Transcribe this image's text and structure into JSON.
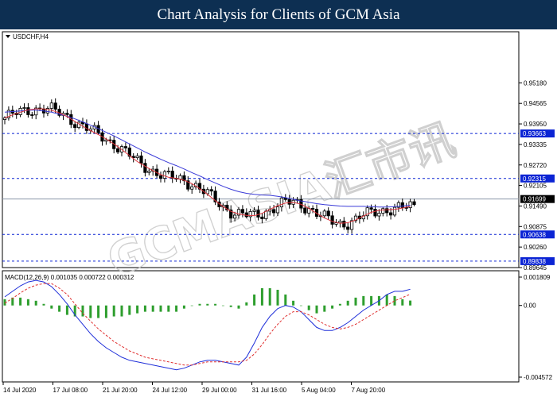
{
  "header": {
    "title": "Chart Analysis for Clients of GCM Asia"
  },
  "watermark": {
    "text": "GCMASIA汇市讯"
  },
  "colors": {
    "banner": "#0d2f52",
    "ma_fast": "#e0343c",
    "ma_slow": "#3a3ad8",
    "bull": "#ffffff",
    "bear": "#000000",
    "level_box": "#0b24d4",
    "macd_hist": "#2e9e2e",
    "macd_main": "#1f2fd9",
    "macd_signal": "#e03030"
  },
  "chart_data": [
    {
      "type": "candlestick",
      "title": "USDCHF,H4",
      "ylim": [
        0.89645,
        0.9614
      ],
      "y_ticks": [
        "0.95180",
        "0.94565",
        "0.93950",
        "0.93335",
        "0.92720",
        "0.92105",
        "0.91490",
        "0.90875",
        "0.90260",
        "0.89645"
      ],
      "x_ticks": [
        "14 Jul 2020",
        "17 Jul 08:00",
        "21 Jul 20:00",
        "24 Jul 12:00",
        "29 Jul 00:00",
        "31 Jul 16:00",
        "5 Aug 04:00",
        "7 Aug 20:00"
      ],
      "levels": [
        {
          "value": 0.93663,
          "label": "0.93663",
          "style": "dashed-blue"
        },
        {
          "value": 0.92315,
          "label": "0.92315",
          "style": "dashed-blue"
        },
        {
          "value": 0.90638,
          "label": "0.90638",
          "style": "dashed-blue"
        },
        {
          "value": 0.89838,
          "label": "0.89838",
          "style": "dashed-blue"
        }
      ],
      "current_price": {
        "value": 0.91699,
        "label": "0.91699"
      },
      "series": [
        {
          "role": "ma_fast",
          "values": [
            0.9413,
            0.9422,
            0.943,
            0.9437,
            0.944,
            0.944,
            0.9436,
            0.9428,
            0.9417,
            0.9402,
            0.9388,
            0.9375,
            0.9363,
            0.935,
            0.9335,
            0.9318,
            0.93,
            0.9282,
            0.9268,
            0.9255,
            0.9243,
            0.9235,
            0.9232,
            0.9226,
            0.9216,
            0.9201,
            0.9184,
            0.9165,
            0.9147,
            0.9133,
            0.9125,
            0.9121,
            0.912,
            0.9127,
            0.9139,
            0.915,
            0.9158,
            0.916,
            0.9154,
            0.9142,
            0.9127,
            0.9113,
            0.9103,
            0.9097,
            0.9099,
            0.9107,
            0.9119,
            0.913,
            0.9136,
            0.9138,
            0.9139,
            0.9143,
            0.9148
          ]
        },
        {
          "role": "ma_slow",
          "values": [
            0.943,
            0.9432,
            0.9434,
            0.9436,
            0.9436,
            0.9434,
            0.943,
            0.9424,
            0.9418,
            0.941,
            0.9401,
            0.9391,
            0.9381,
            0.937,
            0.9359,
            0.9347,
            0.9335,
            0.9323,
            0.9311,
            0.93,
            0.9289,
            0.9279,
            0.927,
            0.926,
            0.9249,
            0.9239,
            0.9228,
            0.9218,
            0.9208,
            0.9199,
            0.9192,
            0.9187,
            0.9184,
            0.9182,
            0.9181,
            0.9178,
            0.9174,
            0.9169,
            0.9164,
            0.916,
            0.9156,
            0.9153,
            0.9151,
            0.9149,
            0.9148,
            0.9148,
            0.9148,
            0.9147,
            0.9146,
            0.9146,
            0.9147,
            0.9149,
            0.9151
          ]
        }
      ]
    },
    {
      "type": "line+bar",
      "title": "MACD(12,26,9) 0.001035 0.000722 0.000312",
      "ylim": [
        -0.004572,
        0.001809
      ],
      "y_ticks": [
        "0.001809",
        "0.00",
        "-0.004572"
      ],
      "series": [
        {
          "role": "macd_main",
          "values": [
            0.00055,
            0.0009,
            0.00125,
            0.0015,
            0.0016,
            0.0015,
            0.0012,
            0.0007,
            0.0001,
            -0.0006,
            -0.0012,
            -0.0018,
            -0.0023,
            -0.0027,
            -0.003,
            -0.0033,
            -0.0035,
            -0.0036,
            -0.0037,
            -0.0038,
            -0.0039,
            -0.004,
            -0.0041,
            -0.004,
            -0.0038,
            -0.0036,
            -0.0035,
            -0.0035,
            -0.0036,
            -0.0037,
            -0.0038,
            -0.0033,
            -0.0024,
            -0.0014,
            -0.0007,
            -0.0002,
            0.0,
            -0.0001,
            -0.0004,
            -0.0009,
            -0.0014,
            -0.0016,
            -0.0016,
            -0.0014,
            -0.0011,
            -0.0007,
            -0.0003,
            0.0,
            0.0003,
            0.0007,
            0.0009,
            0.0009,
            0.001035
          ]
        },
        {
          "role": "macd_signal",
          "values": [
            0.00015,
            0.00045,
            0.0008,
            0.0011,
            0.0013,
            0.0014,
            0.0014,
            0.0011,
            0.0007,
            0.0001,
            -0.0005,
            -0.001,
            -0.0015,
            -0.0019,
            -0.0023,
            -0.0026,
            -0.0029,
            -0.0031,
            -0.0033,
            -0.0034,
            -0.0035,
            -0.0036,
            -0.0037,
            -0.0038,
            -0.0038,
            -0.0037,
            -0.0036,
            -0.0036,
            -0.0036,
            -0.0036,
            -0.0036,
            -0.0035,
            -0.0031,
            -0.0025,
            -0.0018,
            -0.0012,
            -0.0007,
            -0.0004,
            -0.0004,
            -0.0006,
            -0.0009,
            -0.0012,
            -0.0014,
            -0.0015,
            -0.0014,
            -0.0012,
            -0.0009,
            -0.0006,
            -0.0003,
            0.0,
            0.0003,
            0.0005,
            0.000722
          ]
        },
        {
          "role": "macd_hist",
          "values": [
            0.0004,
            0.0005,
            0.0005,
            0.0004,
            0.0003,
            0.0001,
            -0.0002,
            -0.0004,
            -0.0006,
            -0.0007,
            -0.0007,
            -0.0008,
            -0.0008,
            -0.0008,
            -0.0007,
            -0.0007,
            -0.0006,
            -0.0005,
            -0.0004,
            -0.0004,
            -0.0004,
            -0.0004,
            -0.0004,
            -0.0002,
            0.0,
            0.0001,
            0.0001,
            0.0001,
            0.0,
            -0.0001,
            -0.0002,
            0.0002,
            0.0007,
            0.0011,
            0.0011,
            0.001,
            0.0007,
            0.0003,
            0.0,
            -0.0003,
            -0.0005,
            -0.0004,
            -0.0002,
            0.0001,
            0.0003,
            0.0005,
            0.0006,
            0.0006,
            0.0006,
            0.0007,
            0.0006,
            0.0004,
            0.000312
          ]
        }
      ]
    }
  ]
}
